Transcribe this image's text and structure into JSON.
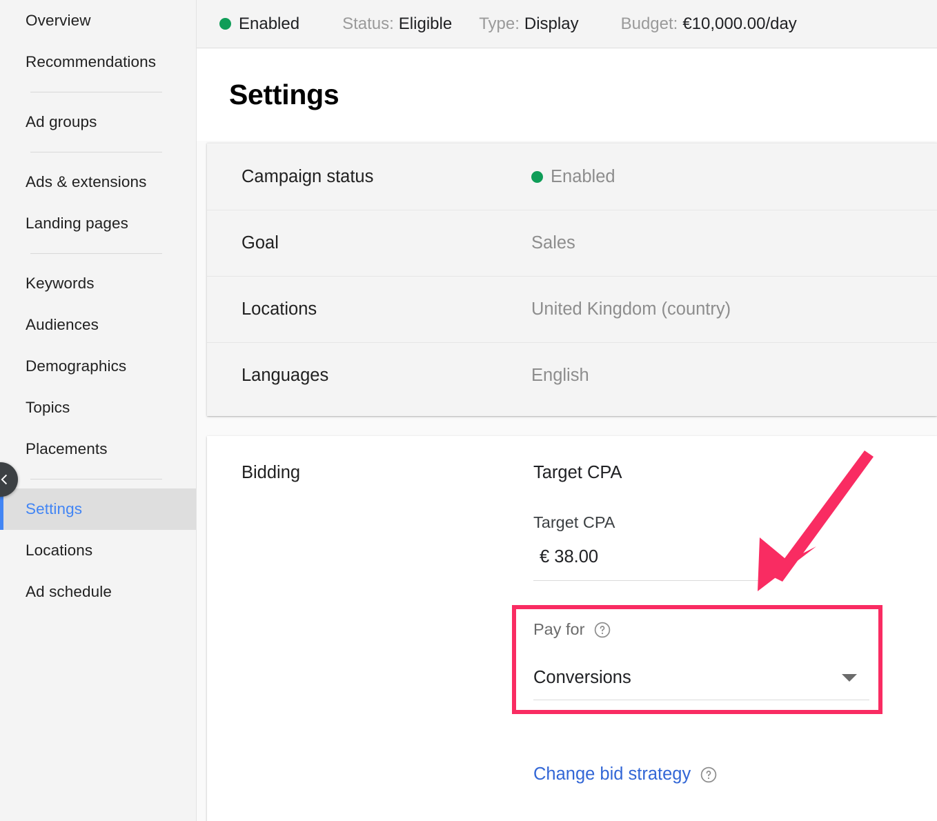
{
  "sidebar": {
    "items": [
      {
        "label": "Overview",
        "active": false,
        "divider_after": false
      },
      {
        "label": "Recommendations",
        "active": false,
        "divider_after": true
      },
      {
        "label": "Ad groups",
        "active": false,
        "divider_after": true
      },
      {
        "label": "Ads & extensions",
        "active": false,
        "divider_after": false
      },
      {
        "label": "Landing pages",
        "active": false,
        "divider_after": true
      },
      {
        "label": "Keywords",
        "active": false,
        "divider_after": false
      },
      {
        "label": "Audiences",
        "active": false,
        "divider_after": false
      },
      {
        "label": "Demographics",
        "active": false,
        "divider_after": false
      },
      {
        "label": "Topics",
        "active": false,
        "divider_after": false
      },
      {
        "label": "Placements",
        "active": false,
        "divider_after": true
      },
      {
        "label": "Settings",
        "active": true,
        "divider_after": false
      },
      {
        "label": "Locations",
        "active": false,
        "divider_after": false
      },
      {
        "label": "Ad schedule",
        "active": false,
        "divider_after": false
      }
    ],
    "collapse_icon": "chevron-left-icon"
  },
  "topbar": {
    "state_icon": "green-status-dot",
    "state": "Enabled",
    "status_label": "Status:",
    "status_value": "Eligible",
    "type_label": "Type:",
    "type_value": "Display",
    "budget_label": "Budget:",
    "budget_value": "€10,000.00/day"
  },
  "header": {
    "title": "Settings"
  },
  "basic_settings": {
    "rows": [
      {
        "label": "Campaign status",
        "value": "Enabled",
        "has_dot": true
      },
      {
        "label": "Goal",
        "value": "Sales",
        "has_dot": false
      },
      {
        "label": "Locations",
        "value": "United Kingdom (country)",
        "has_dot": false
      },
      {
        "label": "Languages",
        "value": "English",
        "has_dot": false
      }
    ]
  },
  "bidding": {
    "label": "Bidding",
    "strategy": "Target CPA",
    "target_cpa_label": "Target CPA",
    "target_cpa_value": "€ 38.00",
    "pay_for_label": "Pay for",
    "pay_for_help_icon": "help-circle-icon",
    "pay_for_value": "Conversions",
    "pay_for_caret_icon": "chevron-down-icon",
    "change_bid_strategy_label": "Change bid strategy",
    "change_bid_strategy_help_icon": "help-circle-icon"
  },
  "annotation": {
    "highlight_color": "#f92c62",
    "arrow_icon": "pink-arrow-pointing-down-left",
    "highlight_target": "Pay for"
  },
  "colors": {
    "accent_blue": "#4285f4",
    "link_blue": "#3367d6",
    "status_green": "#0f9d58",
    "annotation_pink": "#f92c62"
  }
}
